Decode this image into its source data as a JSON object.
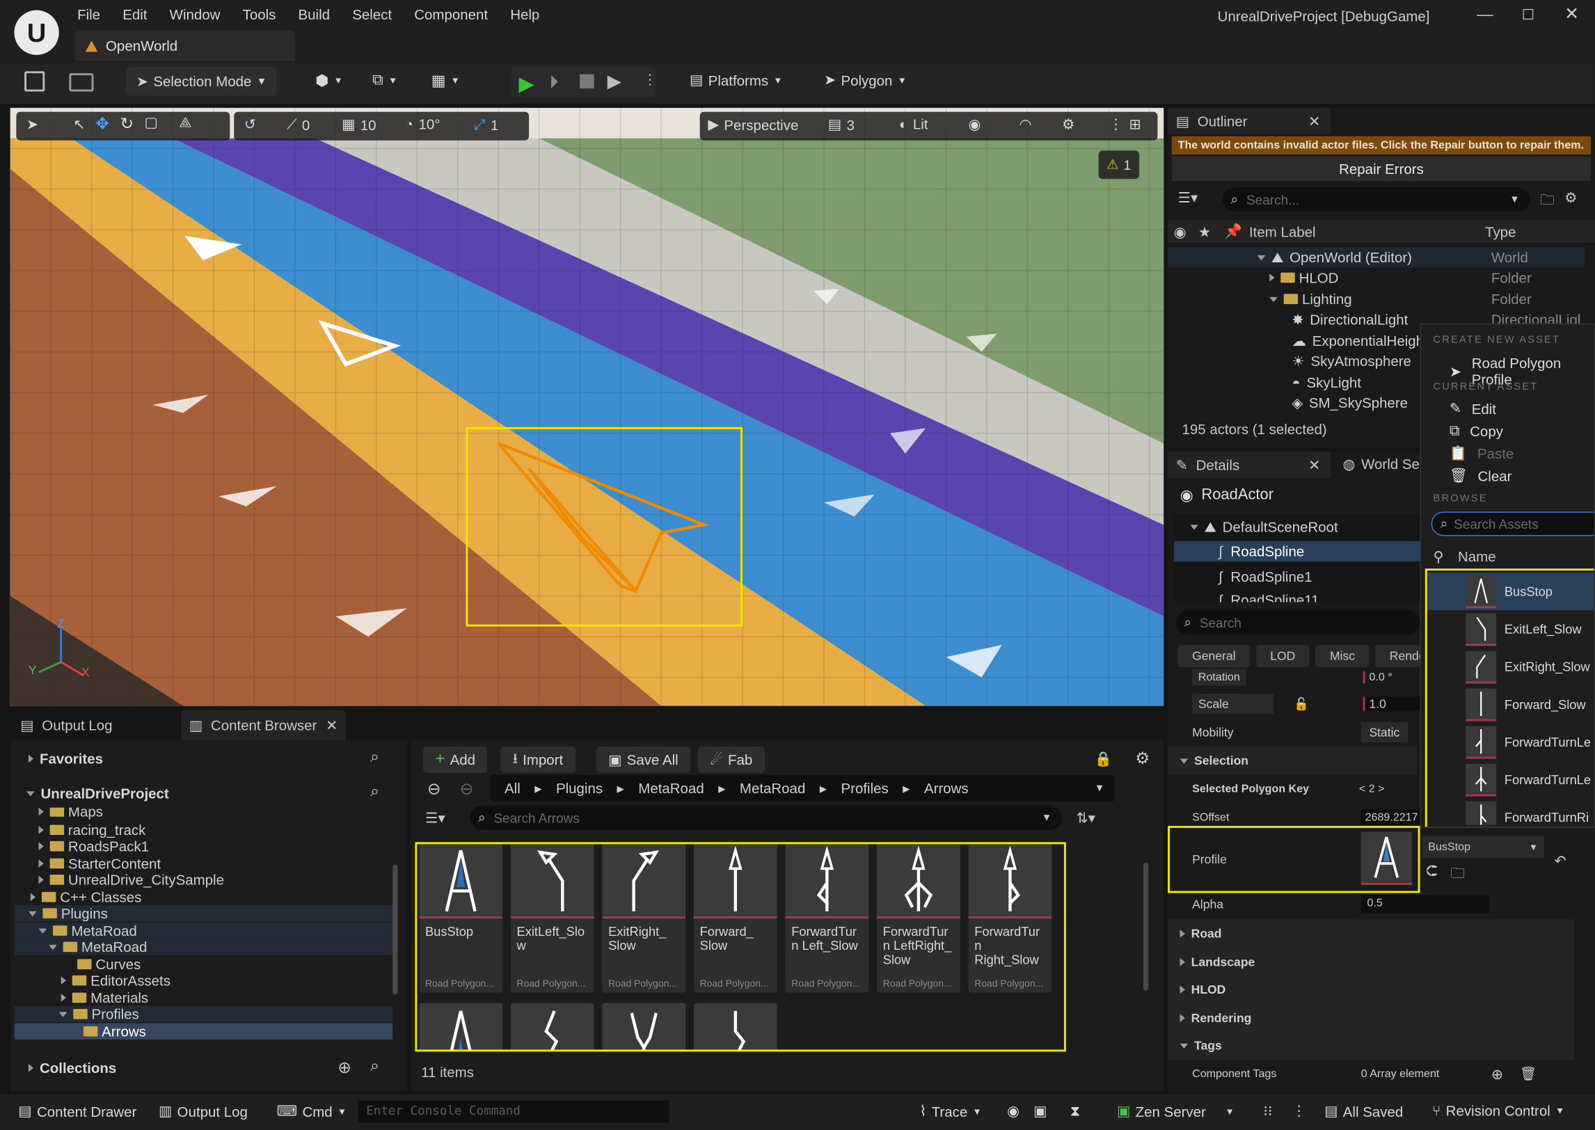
{
  "window": {
    "title": "UnrealDriveProject [DebugGame]",
    "tab": "OpenWorld"
  },
  "menu": [
    "File",
    "Edit",
    "Window",
    "Tools",
    "Build",
    "Select",
    "Component",
    "Help"
  ],
  "toolbar": {
    "selection_mode": "Selection Mode",
    "platforms": "Platforms",
    "polygon": "Polygon"
  },
  "viewport": {
    "perspective": "Perspective",
    "lit": "Lit",
    "rot_snap": "0",
    "grid_snap": "10",
    "angle_snap": "10°",
    "scale_snap": "1",
    "camera_speed": "3",
    "warning_count": "1",
    "axes": {
      "z": "Z",
      "y": "Y",
      "x": "X"
    }
  },
  "outliner": {
    "tab": "Outliner",
    "error_msg": "The world contains invalid actor files. Click the Repair button to repair them.",
    "repair": "Repair Errors",
    "search_placeholder": "Search...",
    "col_label": "Item Label",
    "col_type": "Type",
    "rows": [
      {
        "label": "OpenWorld (Editor)",
        "type": "World"
      },
      {
        "label": "HLOD",
        "type": "Folder"
      },
      {
        "label": "Lighting",
        "type": "Folder"
      },
      {
        "label": "DirectionalLight",
        "type": "DirectionalLigl"
      },
      {
        "label": "ExponentialHeigh",
        "type": ""
      },
      {
        "label": "SkyAtmosphere",
        "type": ""
      },
      {
        "label": "SkyLight",
        "type": ""
      },
      {
        "label": "SM_SkySphere",
        "type": ""
      }
    ],
    "status": "195 actors (1 selected)"
  },
  "details": {
    "tab": "Details",
    "tab2": "World Se",
    "actor": "RoadActor",
    "components": [
      "DefaultSceneRoot",
      "RoadSpline",
      "RoadSpline1",
      "RoadSpline11"
    ],
    "search_placeholder": "Search",
    "filters": [
      "General",
      "LOD",
      "Misc",
      "Rende"
    ],
    "rotation": "Rotation",
    "rotation_val": "0.0 °",
    "scale": "Scale",
    "scale_val": "1.0",
    "mobility": "Mobility",
    "mobility_val": "Static",
    "selection": "Selection",
    "polykey": "Selected Polygon Key",
    "polykey_val": "< 2 >",
    "soffset": "SOffset",
    "soffset_val": "2689.2217",
    "profile": "Profile",
    "profile_val": "BusStop",
    "alpha": "Alpha",
    "alpha_val": "0.5",
    "sections": [
      "Road",
      "Landscape",
      "HLOD",
      "Rendering",
      "Tags"
    ],
    "comp_tags": "Component Tags",
    "comp_tags_val": "0 Array element"
  },
  "asset_menu": {
    "create_hdr": "CREATE NEW ASSET",
    "create_item": "Road Polygon Profile",
    "current_hdr": "CURRENT ASSET",
    "edit": "Edit",
    "copy": "Copy",
    "paste": "Paste",
    "clear": "Clear",
    "browse_hdr": "BROWSE",
    "search_placeholder": "Search Assets",
    "col_name": "Name",
    "assets": [
      "BusStop",
      "ExitLeft_Slow",
      "ExitRight_Slow",
      "Forward_Slow",
      "ForwardTurnLe",
      "ForwardTurnLe",
      "ForwardTurnRi"
    ]
  },
  "bottom": {
    "tab_output": "Output Log",
    "tab_cb": "Content Browser",
    "favorites": "Favorites",
    "project": "UnrealDriveProject",
    "tree": [
      {
        "label": "Maps",
        "indent": 2
      },
      {
        "label": "racing_track",
        "indent": 2
      },
      {
        "label": "RoadsPack1",
        "indent": 2
      },
      {
        "label": "StarterContent",
        "indent": 2
      },
      {
        "label": "UnrealDrive_CitySample",
        "indent": 2
      },
      {
        "label": "C++ Classes",
        "indent": 1
      },
      {
        "label": "Plugins",
        "indent": 1
      },
      {
        "label": "MetaRoad",
        "indent": 2
      },
      {
        "label": "MetaRoad",
        "indent": 3
      },
      {
        "label": "Curves",
        "indent": 4
      },
      {
        "label": "EditorAssets",
        "indent": 4
      },
      {
        "label": "Materials",
        "indent": 4
      },
      {
        "label": "Profiles",
        "indent": 4
      },
      {
        "label": "Arrows",
        "indent": 5
      }
    ],
    "collections": "Collections",
    "add": "Add",
    "import": "Import",
    "save_all": "Save All",
    "fab": "Fab",
    "path": [
      "All",
      "Plugins",
      "MetaRoad",
      "MetaRoad",
      "Profiles",
      "Arrows"
    ],
    "search_placeholder": "Search Arrows",
    "assets": [
      {
        "name": "BusStop",
        "type": "Road Polygon..."
      },
      {
        "name": "ExitLeft_Slow",
        "type": "Road Polygon..."
      },
      {
        "name": "ExitRight_ Slow",
        "type": "Road Polygon..."
      },
      {
        "name": "Forward_ Slow",
        "type": "Road Polygon..."
      },
      {
        "name": "ForwardTurn Left_Slow",
        "type": "Road Polygon..."
      },
      {
        "name": "ForwardTurn LeftRight_ Slow",
        "type": "Road Polygon..."
      },
      {
        "name": "ForwardTurn Right_Slow",
        "type": "Road Polygon..."
      }
    ],
    "count": "11 items"
  },
  "statusbar": {
    "content_drawer": "Content Drawer",
    "output_log": "Output Log",
    "cmd": "Cmd",
    "console_placeholder": "Enter Console Command",
    "trace": "Trace",
    "zen": "Zen Server",
    "saved": "All Saved",
    "revision": "Revision Control"
  }
}
